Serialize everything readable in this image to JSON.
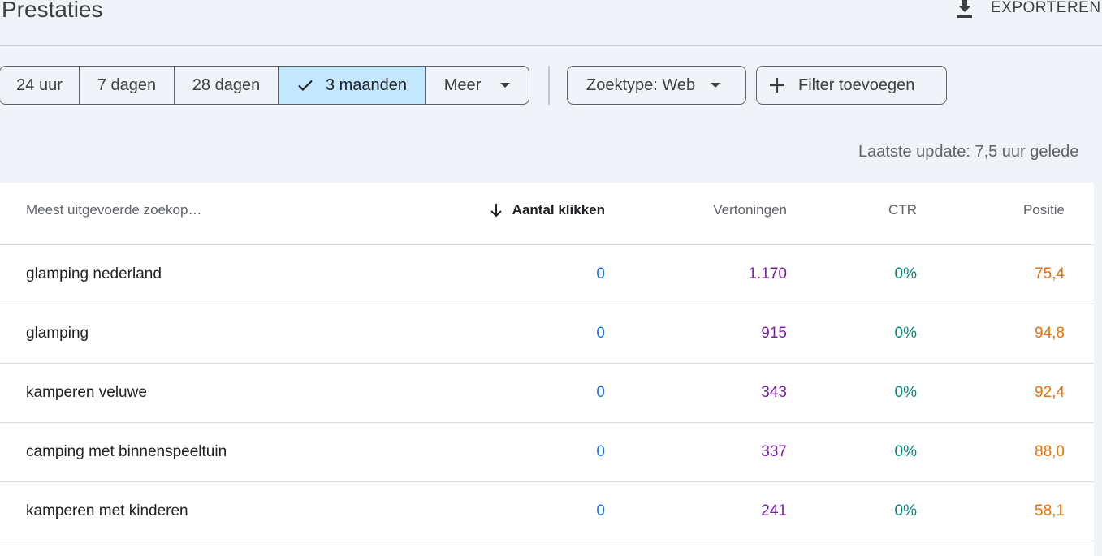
{
  "page": {
    "title": "Prestaties",
    "export_label": "EXPORTEREN",
    "export_icon": "download-icon"
  },
  "date_range": {
    "options": [
      "24 uur",
      "7 dagen",
      "28 dagen",
      "3 maanden"
    ],
    "selected": "3 maanden",
    "more_label": "Meer"
  },
  "filters": {
    "search_type_label": "Zoektype: Web",
    "add_filter_label": "Filter toevoegen"
  },
  "status": {
    "last_update": "Laatste update: 7,5 uur gelede"
  },
  "table": {
    "columns": {
      "query": "Meest uitgevoerde zoekop…",
      "clicks": "Aantal klikken",
      "impressions": "Vertoningen",
      "ctr": "CTR",
      "position": "Positie"
    },
    "sort_column": "clicks",
    "sort_direction": "descending",
    "rows": [
      {
        "query": "glamping nederland",
        "clicks": "0",
        "impressions": "1.170",
        "ctr": "0%",
        "position": "75,4"
      },
      {
        "query": "glamping",
        "clicks": "0",
        "impressions": "915",
        "ctr": "0%",
        "position": "94,8"
      },
      {
        "query": "kamperen veluwe",
        "clicks": "0",
        "impressions": "343",
        "ctr": "0%",
        "position": "92,4"
      },
      {
        "query": "camping met binnenspeeltuin",
        "clicks": "0",
        "impressions": "337",
        "ctr": "0%",
        "position": "88,0"
      },
      {
        "query": "kamperen met kinderen",
        "clicks": "0",
        "impressions": "241",
        "ctr": "0%",
        "position": "58,1"
      }
    ]
  },
  "colors": {
    "clicks": "#1a73e8",
    "impressions": "#7b1fa2",
    "ctr": "#00897b",
    "position": "#e8710a",
    "selected_chip": "#c2e7ff"
  }
}
